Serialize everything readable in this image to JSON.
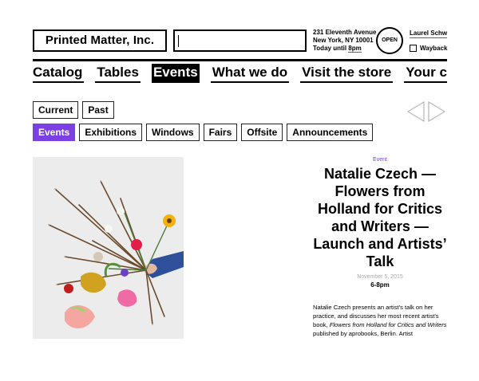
{
  "header": {
    "logo": "Printed Matter, Inc.",
    "search": {
      "value": "",
      "placeholder": ""
    },
    "address": {
      "line1": "231 Eleventh Avenue",
      "line2": "New York, NY 10001",
      "line3_prefix": "Today until ",
      "line3_hours": "8pm"
    },
    "open_badge": "OPEN",
    "user_link": "Laurel Schwulst",
    "wayback_label": "Wayback"
  },
  "nav": {
    "items": [
      {
        "label": "Catalog",
        "active": false
      },
      {
        "label": "Tables",
        "active": false
      },
      {
        "label": "Events",
        "active": true
      },
      {
        "label": "What we do",
        "active": false
      },
      {
        "label": "Visit the store",
        "active": false
      },
      {
        "label": "Your cart",
        "active": false
      }
    ]
  },
  "time_tabs": [
    {
      "label": "Current",
      "active": false
    },
    {
      "label": "Past",
      "active": false
    }
  ],
  "category_tabs": [
    {
      "label": "Events",
      "active": true
    },
    {
      "label": "Exhibitions",
      "active": false
    },
    {
      "label": "Windows",
      "active": false
    },
    {
      "label": "Fairs",
      "active": false
    },
    {
      "label": "Offsite",
      "active": false
    },
    {
      "label": "Announcements",
      "active": false
    }
  ],
  "pager": {
    "prev_icon": "triangle-left-icon",
    "next_icon": "triangle-right-icon"
  },
  "event": {
    "kicker": "Event",
    "title": "Natalie Czech — Flowers from Holland for Critics and Writers — Launch and Artists’ Talk",
    "date": "November 5, 2015",
    "time": "6-8pm",
    "desc_part1": "Natalie Czech presents an artist's talk on her practice, and discusses her most recent artist's book, ",
    "desc_italic": "Flowers from Holland for Critics and Writers",
    "desc_part2": " published by aprobooks, Berlin. Artist"
  },
  "colors": {
    "accent": "#7b3fe4",
    "highlight": "#d81b8f"
  }
}
